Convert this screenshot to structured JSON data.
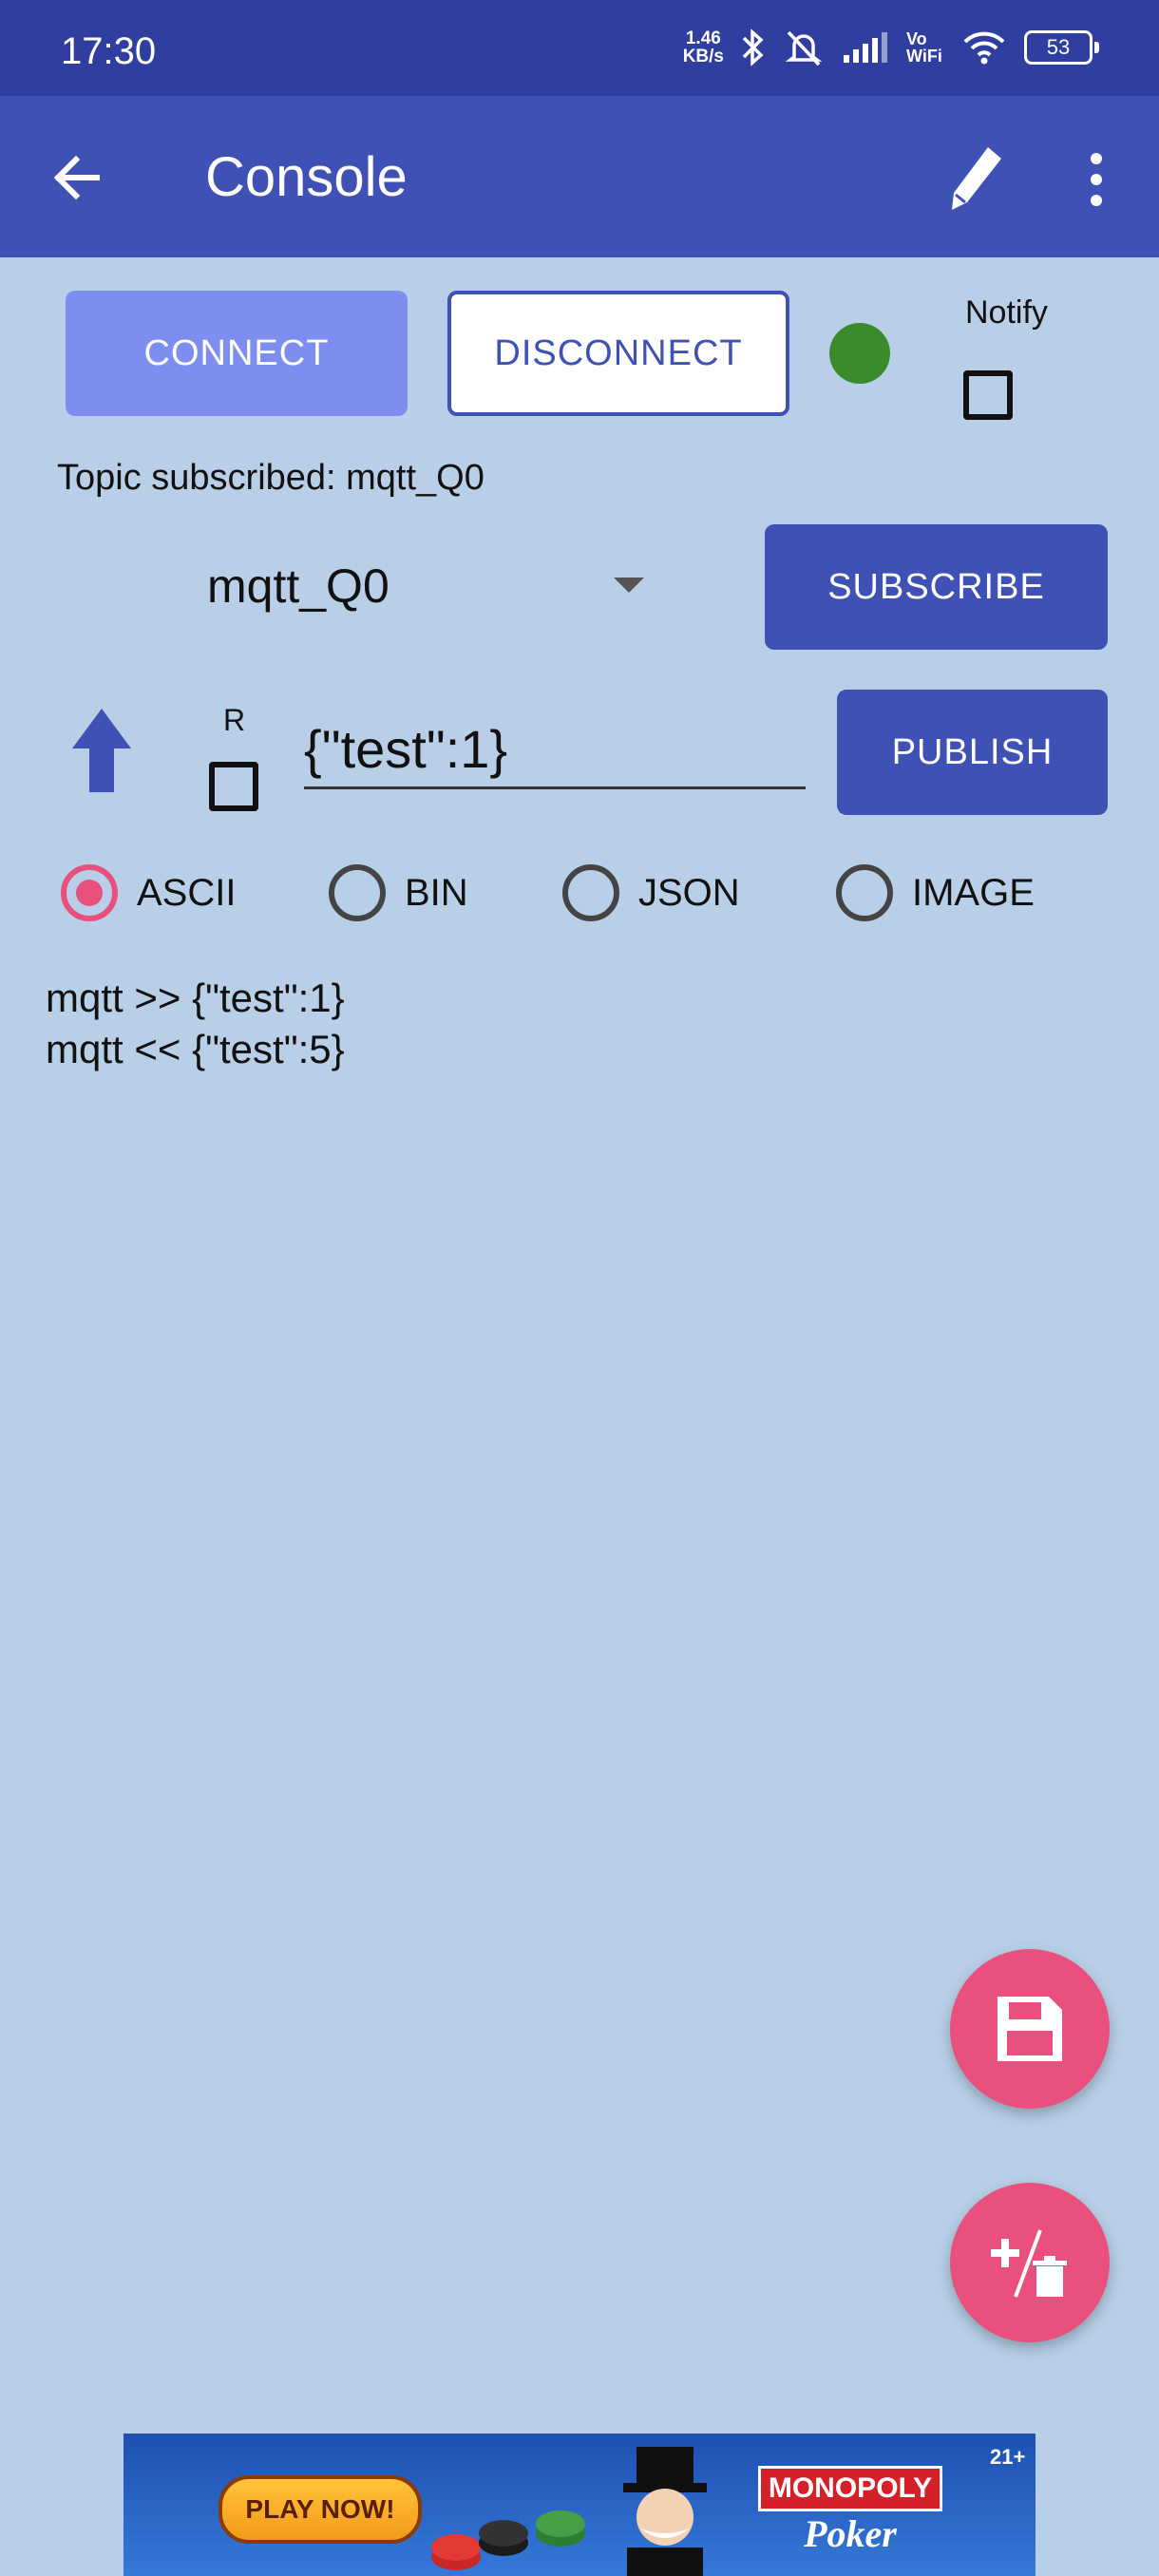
{
  "status_bar": {
    "time": "17:30",
    "net_speed_value": "1.46",
    "net_speed_unit": "KB/s",
    "wifi_label": "Vo WiFi",
    "battery": "53"
  },
  "app_bar": {
    "title": "Console"
  },
  "connection": {
    "connect_label": "CONNECT",
    "disconnect_label": "DISCONNECT",
    "status_color": "#3b8a2b",
    "notify_label": "Notify",
    "notify_checked": false
  },
  "subscription": {
    "subscribed_text": "Topic subscribed: mqtt_Q0",
    "selected_topic": "mqtt_Q0",
    "subscribe_label": "SUBSCRIBE"
  },
  "publish": {
    "retain_label": "R",
    "retain_checked": false,
    "payload_value": "{\"test\":1}",
    "publish_label": "PUBLISH"
  },
  "format_options": [
    {
      "label": "ASCII",
      "selected": true
    },
    {
      "label": "BIN",
      "selected": false
    },
    {
      "label": "JSON",
      "selected": false
    },
    {
      "label": "IMAGE",
      "selected": false
    }
  ],
  "console": {
    "lines": [
      "mqtt >> {\"test\":1}",
      "mqtt << {\"test\":5}"
    ]
  },
  "fabs": {
    "save_icon": "floppy-disk-icon",
    "clear_icon": "add-delete-icon"
  },
  "ad": {
    "play_button": "PLAY NOW!",
    "brand": "MONOPOLY",
    "sub_brand": "Poker",
    "age_rating": "21+"
  },
  "colors": {
    "primary": "#3f51b5",
    "primary_dark": "#303f9f",
    "accent": "#e9507e",
    "background": "#b8cfe7",
    "connect_button": "#7e8ef0"
  }
}
